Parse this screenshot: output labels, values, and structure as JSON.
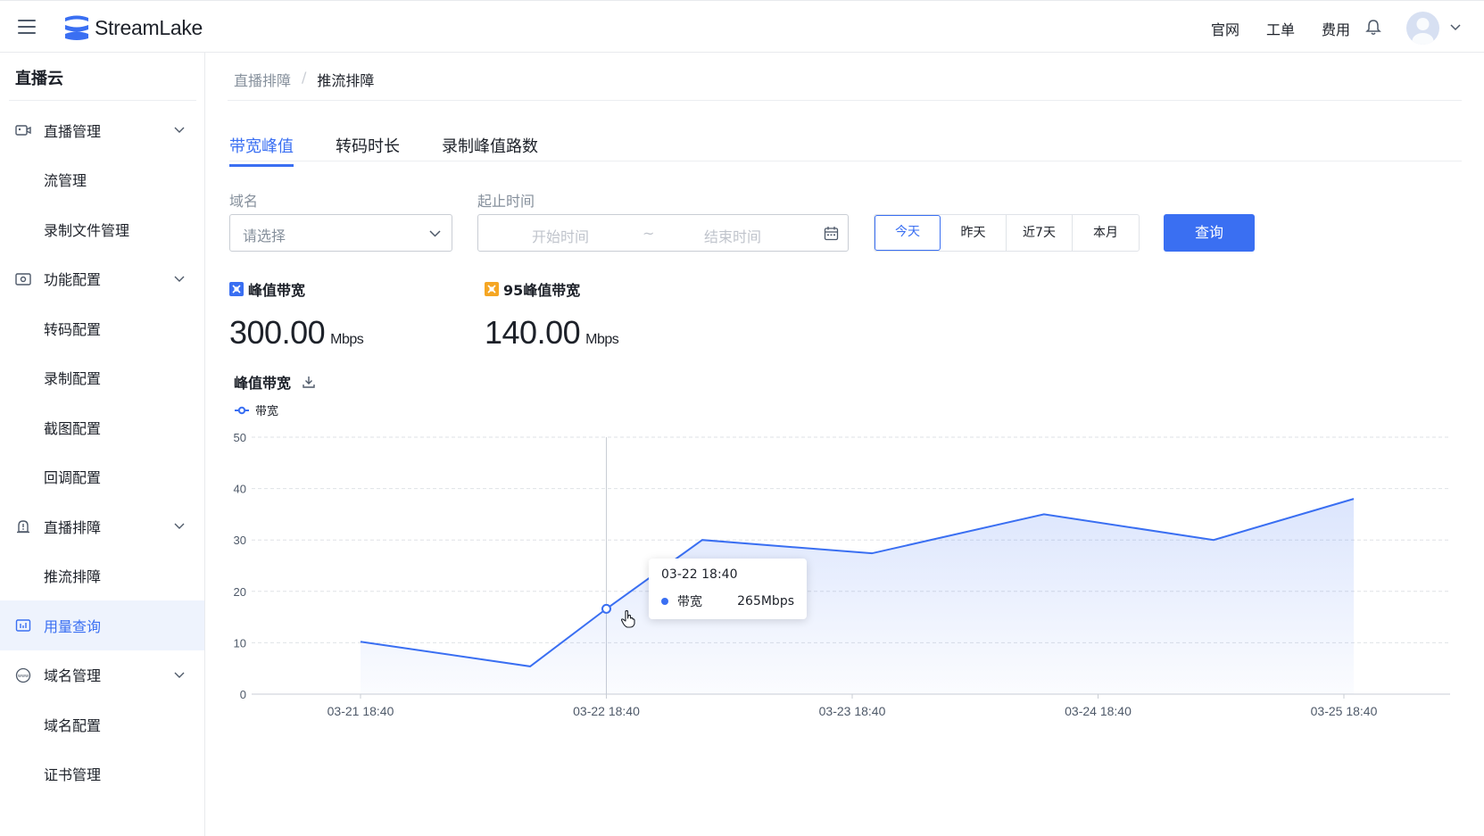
{
  "topbar": {
    "brand": "StreamLake",
    "links": [
      "官网",
      "工单",
      "费用"
    ],
    "icons": {
      "menu": "hamburger-icon",
      "notification": "bell-icon",
      "avatar": "user-avatar",
      "dropdown": "chevron-down-icon"
    }
  },
  "sidebar": {
    "title": "直播云",
    "items": [
      {
        "label": "直播管理",
        "type": "group",
        "icon": "video-icon"
      },
      {
        "label": "流管理",
        "type": "child"
      },
      {
        "label": "录制文件管理",
        "type": "child"
      },
      {
        "label": "功能配置",
        "type": "group",
        "icon": "config-icon"
      },
      {
        "label": "转码配置",
        "type": "child"
      },
      {
        "label": "录制配置",
        "type": "child"
      },
      {
        "label": "截图配置",
        "type": "child"
      },
      {
        "label": "回调配置",
        "type": "child"
      },
      {
        "label": "直播排障",
        "type": "group",
        "icon": "alert-icon"
      },
      {
        "label": "推流排障",
        "type": "child"
      },
      {
        "label": "用量查询",
        "type": "active",
        "icon": "chart-icon"
      },
      {
        "label": "域名管理",
        "type": "group",
        "icon": "www-icon"
      },
      {
        "label": "域名配置",
        "type": "child"
      },
      {
        "label": "证书管理",
        "type": "child"
      }
    ]
  },
  "breadcrumb": {
    "parent": "直播排障",
    "separator": "/",
    "current": "推流排障"
  },
  "tabs": [
    {
      "label": "带宽峰值",
      "active": true
    },
    {
      "label": "转码时长",
      "active": false
    },
    {
      "label": "录制峰值路数",
      "active": false
    }
  ],
  "filters": {
    "domain_label": "域名",
    "domain_placeholder": "请选择",
    "time_label": "起止时间",
    "start_placeholder": "开始时间",
    "range_sep": "~",
    "end_placeholder": "结束时间",
    "quick": [
      "今天",
      "昨天",
      "近7天",
      "本月"
    ],
    "quick_selected": "今天",
    "query_button": "查询"
  },
  "stats": [
    {
      "title": "峰值带宽",
      "value": "300.00",
      "unit": "Mbps",
      "color": "#3a6ff2"
    },
    {
      "title": "95峰值带宽",
      "value": "140.00",
      "unit": "Mbps",
      "color": "#f5a623"
    }
  ],
  "chart_title": "峰值带宽",
  "chart_data": {
    "type": "area",
    "legend": [
      "带宽"
    ],
    "ylim": [
      0,
      50
    ],
    "yticks": [
      0,
      10,
      20,
      30,
      40,
      50
    ],
    "xticks": [
      "03-21 18:40",
      "03-22 18:40",
      "03-23 18:40",
      "03-24 18:40",
      "03-25 18:40"
    ],
    "series": [
      {
        "name": "带宽",
        "color": "#3a6ff2",
        "points": [
          [
            0.0,
            10.2
          ],
          [
            0.69,
            5.4
          ],
          [
            1.0,
            16.6
          ],
          [
            1.39,
            30
          ],
          [
            2.08,
            27.4
          ],
          [
            2.78,
            35
          ],
          [
            3.47,
            30
          ],
          [
            4.04,
            38
          ]
        ]
      }
    ],
    "grid": true
  },
  "tooltip": {
    "date": "03-22 18:40",
    "series": "带宽",
    "value": "265Mbps"
  }
}
